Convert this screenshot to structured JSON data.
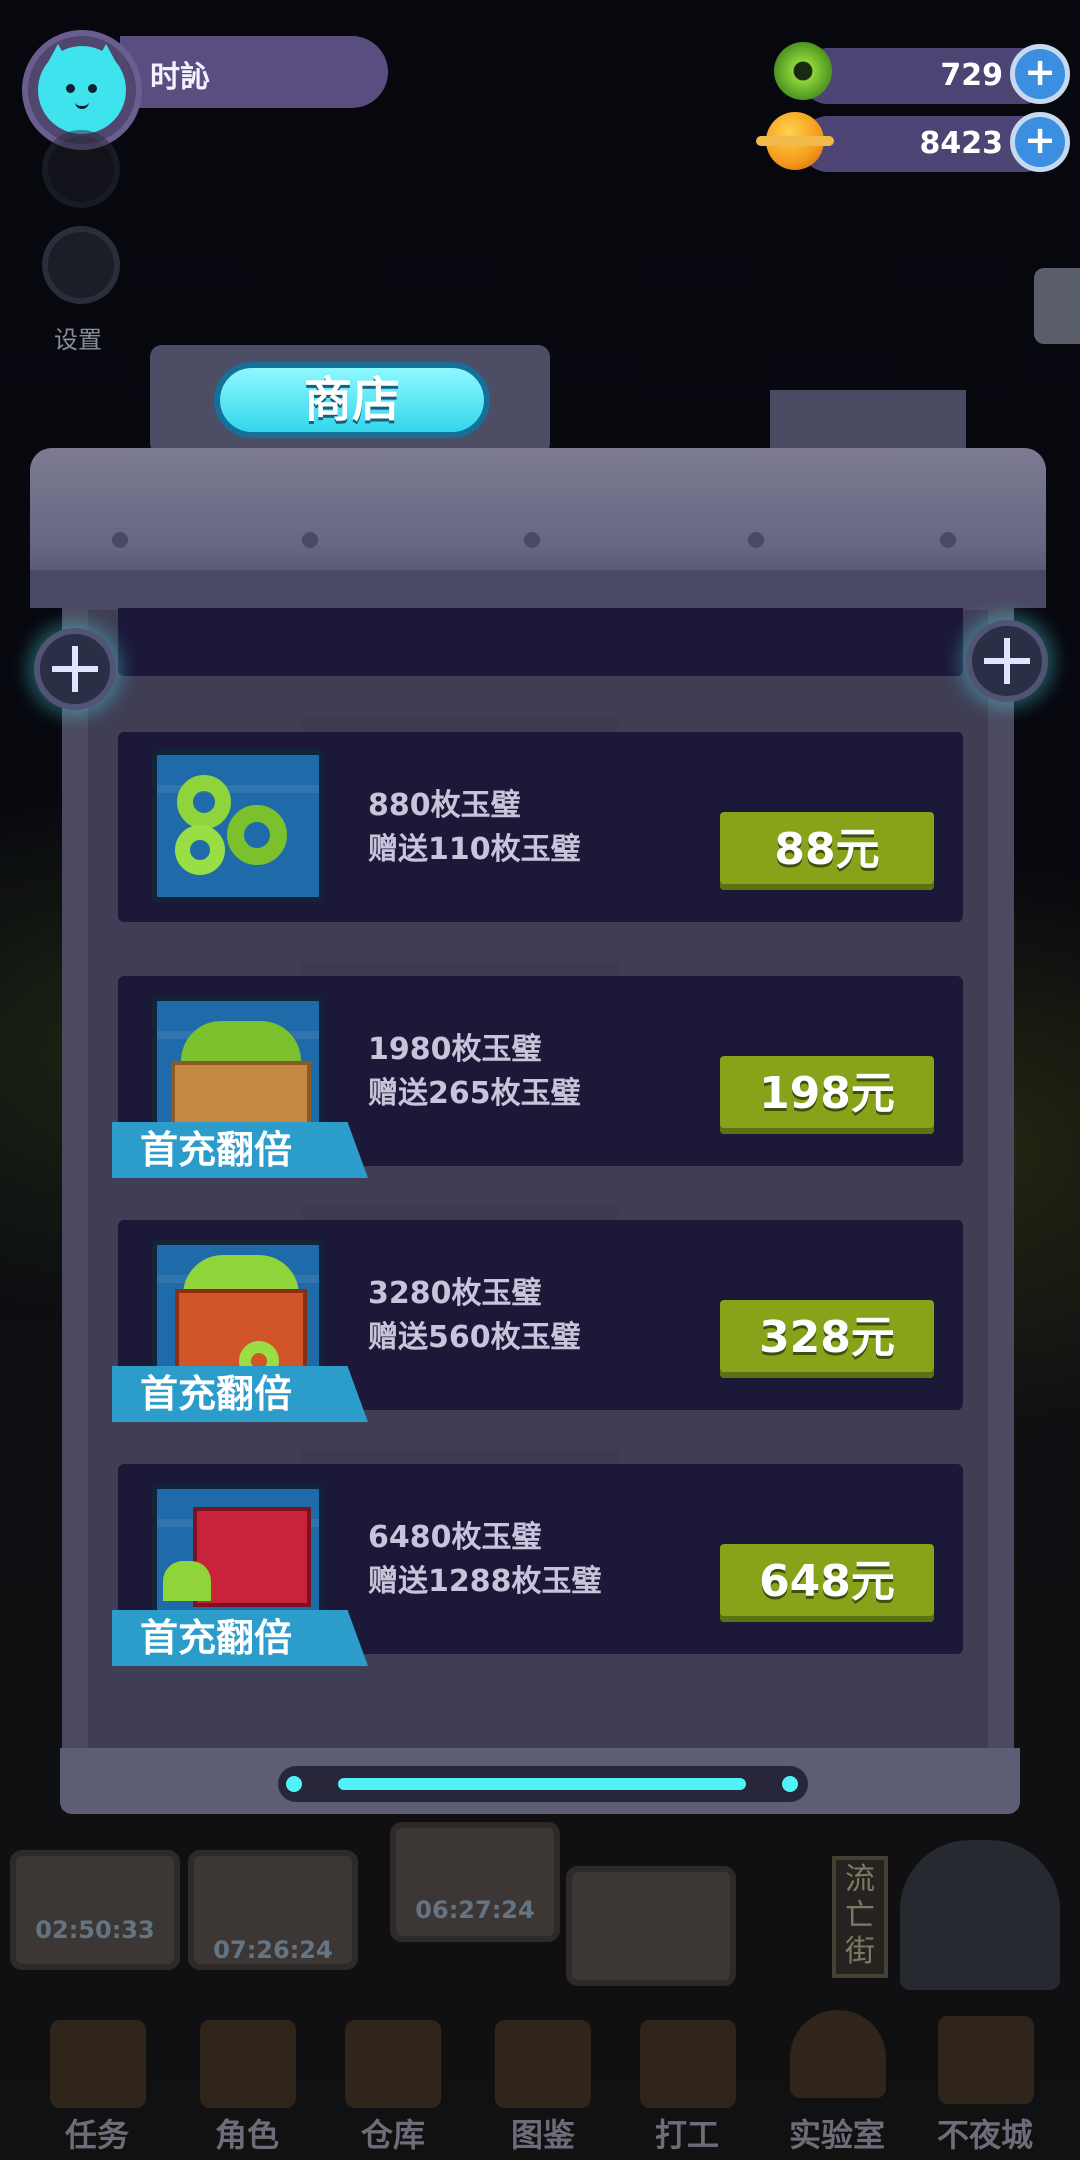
{
  "top_bar": {
    "player_name": "时訫",
    "resources": [
      {
        "icon": "jade-ring-icon",
        "value": "729"
      },
      {
        "icon": "planet-coin-icon",
        "value": "8423"
      }
    ],
    "settings_label": "设置"
  },
  "shop": {
    "title": "商店",
    "items": [
      {
        "line1": "880枚玉璧",
        "line2": "赠送110枚玉璧",
        "price": "88元",
        "badge": ""
      },
      {
        "line1": "1980枚玉璧",
        "line2": "赠送265枚玉璧",
        "price": "198元",
        "badge": "首充翻倍"
      },
      {
        "line1": "3280枚玉璧",
        "line2": "赠送560枚玉璧",
        "price": "328元",
        "badge": "首充翻倍"
      },
      {
        "line1": "6480枚玉璧",
        "line2": "赠送1288枚玉璧",
        "price": "648元",
        "badge": "首充翻倍"
      }
    ]
  },
  "scene": {
    "timers": [
      "02:50:33",
      "07:26:24",
      "06:27:24"
    ],
    "street_sign": "流亡街"
  },
  "bottom_nav": [
    "任务",
    "角色",
    "仓库",
    "图鉴",
    "打工",
    "实验室",
    "不夜城"
  ],
  "colors": {
    "accent_cyan": "#4ff3f8",
    "price_green": "#86a31a",
    "badge_blue": "#2c9ccb",
    "panel_dark": "#1c1838"
  }
}
